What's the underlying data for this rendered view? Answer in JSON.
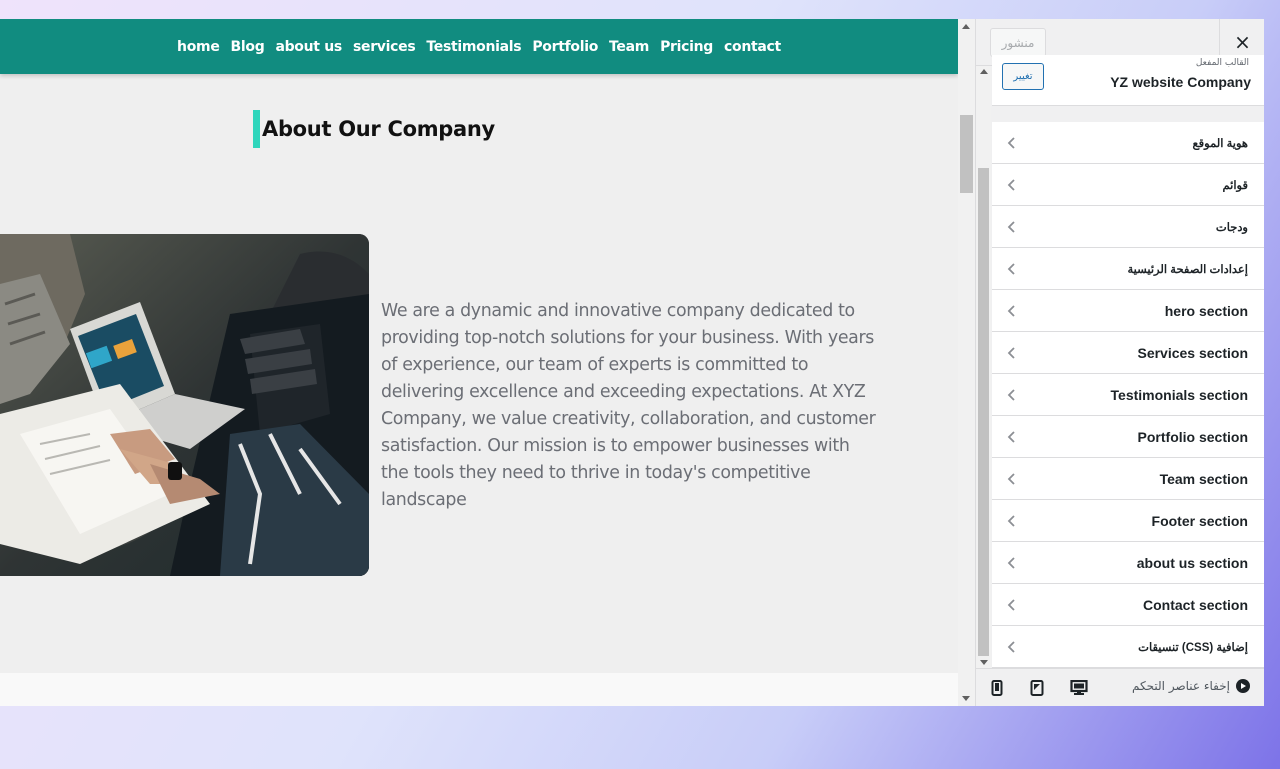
{
  "nav": {
    "items": [
      "home",
      "Blog",
      "about us",
      "services",
      "Testimonials",
      "Portfolio",
      "Team",
      "Pricing",
      "contact"
    ]
  },
  "about": {
    "heading": "About Our Company",
    "paragraph": "We are a dynamic and innovative company dedicated to providing top-notch solutions for your business. With years of experience, our team of experts is committed to delivering excellence and exceeding expectations. At XYZ Company, we value creativity, collaboration, and customer satisfaction. Our mission is to empower businesses with the tools they need to thrive in today's competitive landscape"
  },
  "customizer": {
    "close_icon": "×",
    "publish_label": "منشور",
    "theme_small_label": "القالب المفعل",
    "theme_name": "YZ website Company",
    "change_theme_label": "تغيير",
    "sections": [
      {
        "label": "هوية الموقع",
        "ar": true
      },
      {
        "label": "قوائم",
        "ar": true
      },
      {
        "label": "ودجات",
        "ar": true
      },
      {
        "label": "إعدادات الصفحة الرئيسية",
        "ar": true
      },
      {
        "label": "hero section",
        "ar": false
      },
      {
        "label": "Services section",
        "ar": false
      },
      {
        "label": "Testimonials section",
        "ar": false
      },
      {
        "label": "Portfolio section",
        "ar": false
      },
      {
        "label": "Team section",
        "ar": false
      },
      {
        "label": "Footer section",
        "ar": false
      },
      {
        "label": "about us section",
        "ar": false
      },
      {
        "label": "Contact section",
        "ar": false
      },
      {
        "label": "تنسيقات (CSS) إضافية",
        "ar": true
      }
    ],
    "hide_controls_label": "إخفاء عناصر التحكم",
    "devices": [
      "desktop-icon",
      "tablet-icon",
      "mobile-icon"
    ]
  },
  "colors": {
    "nav_bg": "#118c80",
    "heading_accent": "#2fd6bc",
    "wp_blue": "#2271b1"
  }
}
